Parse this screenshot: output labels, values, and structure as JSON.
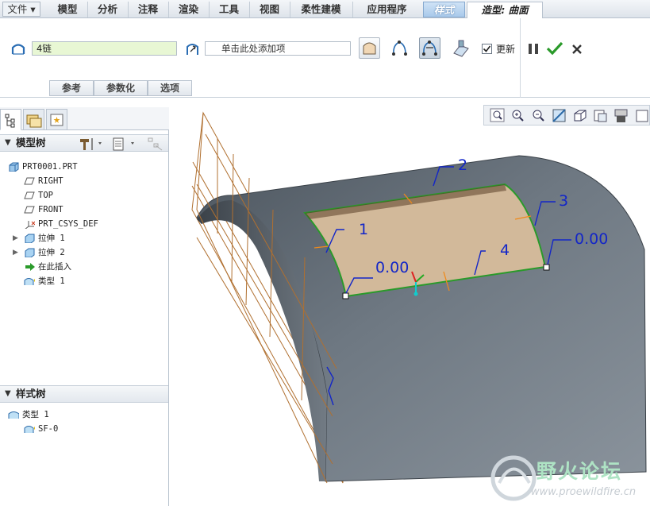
{
  "menu": {
    "file": "文件",
    "tabs": [
      "模型",
      "分析",
      "注释",
      "渲染",
      "工具",
      "视图",
      "柔性建模",
      "应用程序"
    ],
    "style_tab": "样式",
    "active_tab": "造型: 曲面"
  },
  "dashboard": {
    "chain_value": "4链",
    "add_item_placeholder": "单击此处添加项",
    "update_label": "更新",
    "update_checked": true,
    "subtabs": [
      "参考",
      "参数化",
      "选项"
    ],
    "icons": [
      "surface-chain-icon",
      "add-item-icon",
      "surface-preview-icon",
      "connect-icon",
      "interior-curve-icon",
      "display-icon",
      "pause-icon",
      "ok-icon",
      "cancel-icon"
    ]
  },
  "left_panel": {
    "model_tree_title": "模型树",
    "model_tree": [
      {
        "label": "PRT0001.PRT",
        "icon": "part-icon",
        "indent": 0
      },
      {
        "label": "RIGHT",
        "icon": "datum-plane-icon",
        "indent": 1
      },
      {
        "label": "TOP",
        "icon": "datum-plane-icon",
        "indent": 1
      },
      {
        "label": "FRONT",
        "icon": "datum-plane-icon",
        "indent": 1
      },
      {
        "label": "PRT_CSYS_DEF",
        "icon": "csys-icon",
        "indent": 1
      },
      {
        "label": "拉伸 1",
        "icon": "extrude-icon",
        "indent": 1,
        "expandable": true
      },
      {
        "label": "拉伸 2",
        "icon": "extrude-icon",
        "indent": 1,
        "expandable": true
      },
      {
        "label": "在此插入",
        "icon": "insert-arrow-icon",
        "indent": 1
      },
      {
        "label": "类型 1",
        "icon": "style-feature-icon",
        "indent": 1
      }
    ],
    "style_tree_title": "样式树",
    "style_tree": [
      {
        "label": "类型 1",
        "icon": "style-feature-icon",
        "indent": 0
      },
      {
        "label": "SF-0",
        "icon": "style-surface-icon",
        "indent": 1
      }
    ]
  },
  "viewport": {
    "labels": [
      "1",
      "2",
      "3",
      "4"
    ],
    "tangent_values": [
      "0.00",
      "0.00"
    ],
    "toolbar_icons": [
      "zoom-fit-icon",
      "zoom-in-icon",
      "zoom-out-icon",
      "repaint-icon",
      "view-orient-icon",
      "saved-views-icon",
      "display-style-icon",
      "more-icon"
    ],
    "watermark": {
      "title": "野火论坛",
      "url": "www.proewildfire.cn"
    },
    "colors": {
      "surface": "#6c7680",
      "patch": "#d2b99a",
      "boundary": "#2a9a2a",
      "annotation": "#1326c8",
      "plane": "#b07030"
    }
  }
}
